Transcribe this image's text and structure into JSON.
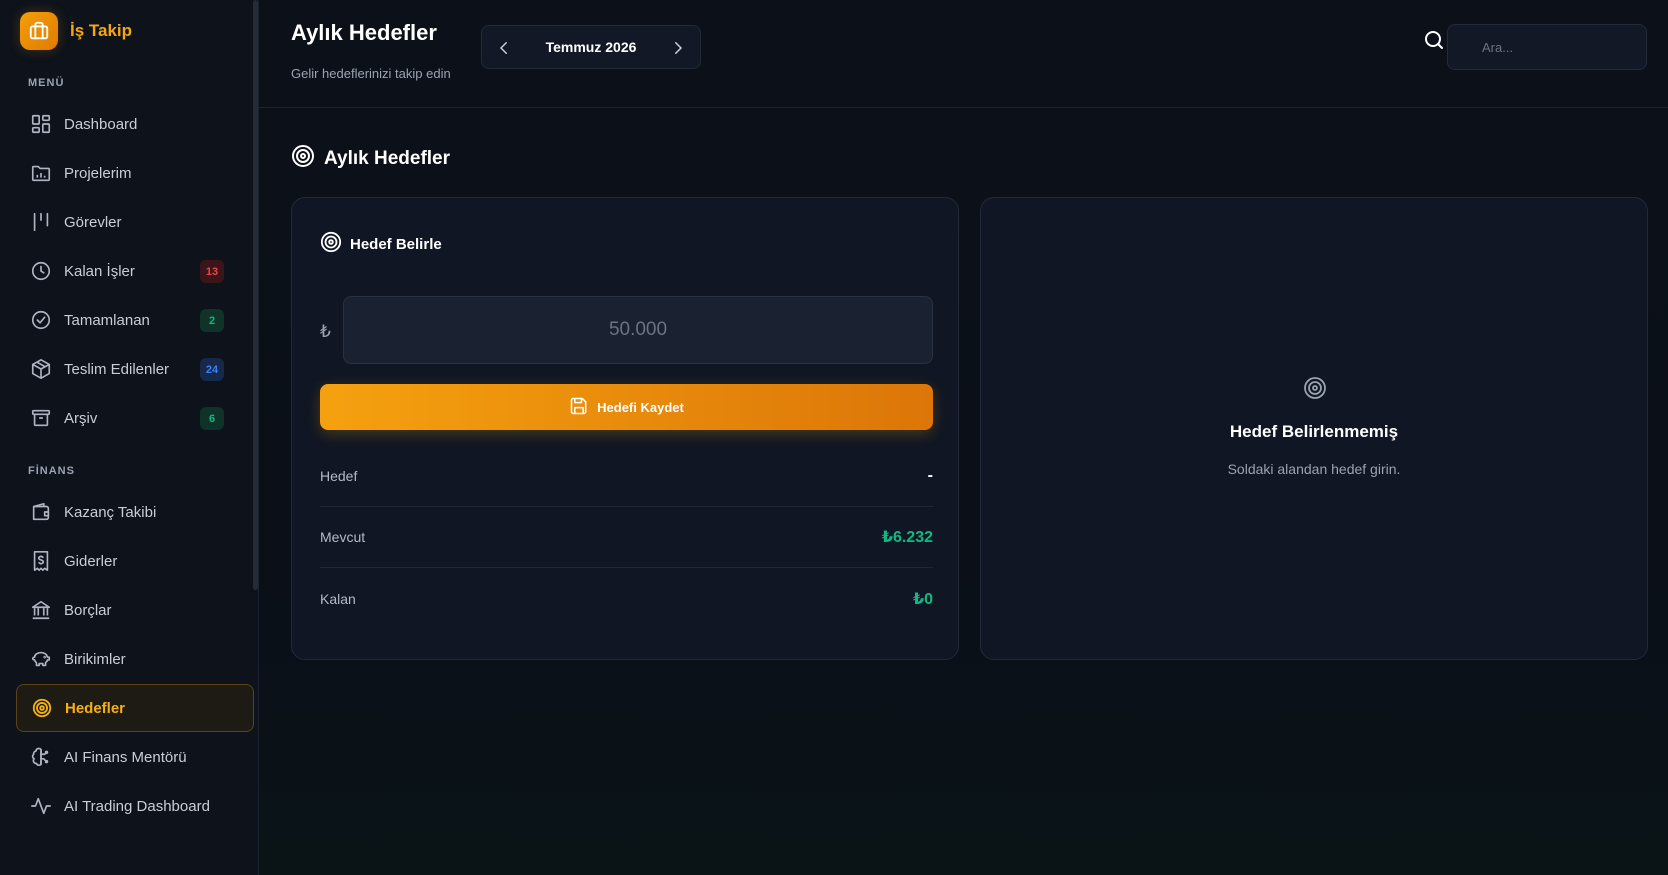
{
  "brand": {
    "name": "İş Takip",
    "accent": "#f59e0b"
  },
  "sidebar": {
    "menu_label": "MENÜ",
    "finance_label": "FİNANS",
    "menu_items": [
      {
        "label": "Dashboard",
        "icon": "dashboard-icon"
      },
      {
        "label": "Projelerim",
        "icon": "folder-chart-icon"
      },
      {
        "label": "Görevler",
        "icon": "kanban-icon"
      },
      {
        "label": "Kalan İşler",
        "icon": "clock-icon",
        "badge": "13",
        "badge_color": "#ef4444"
      },
      {
        "label": "Tamamlanan",
        "icon": "check-circle-icon",
        "badge": "2",
        "badge_color": "#10b981"
      },
      {
        "label": "Teslim Edilenler",
        "icon": "package-icon",
        "badge": "24",
        "badge_color": "#3b82f6"
      },
      {
        "label": "Arşiv",
        "icon": "archive-icon",
        "badge": "6",
        "badge_color": "#10b981"
      }
    ],
    "finance_items": [
      {
        "label": "Kazanç Takibi",
        "icon": "wallet-icon"
      },
      {
        "label": "Giderler",
        "icon": "receipt-icon"
      },
      {
        "label": "Borçlar",
        "icon": "bank-icon"
      },
      {
        "label": "Birikimler",
        "icon": "piggy-bank-icon"
      },
      {
        "label": "Hedefler",
        "icon": "target-icon",
        "active": true
      },
      {
        "label": "AI Finans Mentörü",
        "icon": "brain-icon"
      },
      {
        "label": "AI Trading Dashboard",
        "icon": "activity-icon"
      }
    ]
  },
  "header": {
    "title": "Aylık Hedefler",
    "subtitle": "Gelir hedeflerinizi takip edin",
    "month": "Temmuz 2026",
    "search_placeholder": "Ara..."
  },
  "main": {
    "section_title": "Aylık Hedefler",
    "goal_card": {
      "title": "Hedef Belirle",
      "currency_symbol": "₺",
      "amount_placeholder": "50.000",
      "save_label": "Hedefi Kaydet",
      "stats": [
        {
          "label": "Hedef",
          "value": "-",
          "color": "#ffffff"
        },
        {
          "label": "Mevcut",
          "value": "₺6.232",
          "color": "#10b981"
        },
        {
          "label": "Kalan",
          "value": "₺0",
          "color": "#10b981"
        }
      ]
    },
    "empty_card": {
      "title": "Hedef Belirlenmemiş",
      "subtitle": "Soldaki alandan hedef girin."
    }
  }
}
